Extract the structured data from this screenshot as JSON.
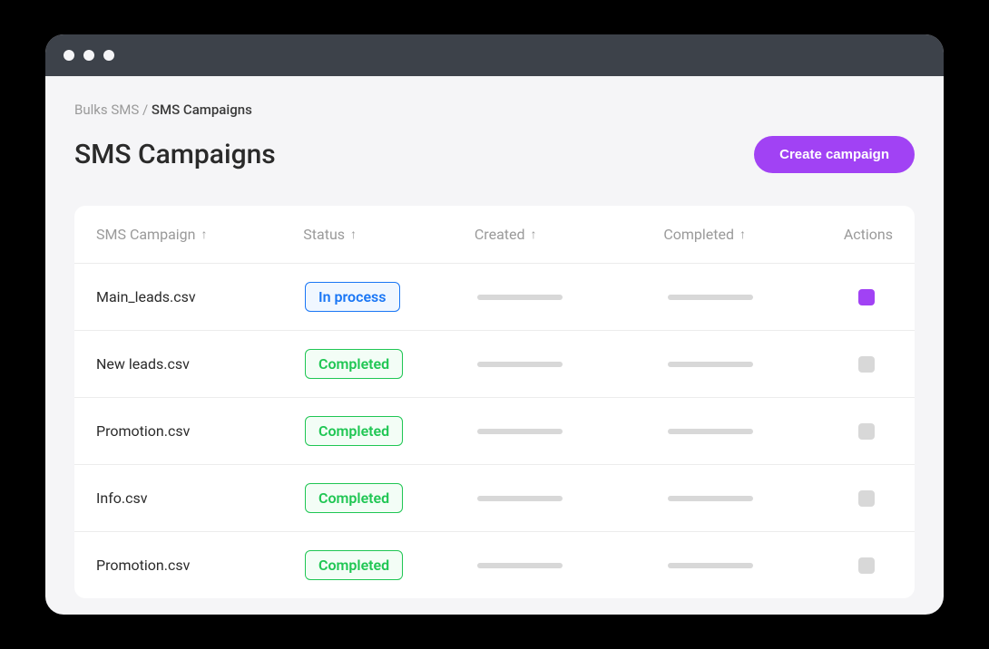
{
  "breadcrumb": {
    "parent": "Bulks SMS",
    "separator": "/",
    "current": "SMS Campaigns"
  },
  "page_title": "SMS Campaigns",
  "create_button_label": "Create campaign",
  "table": {
    "headers": {
      "name": "SMS Campaign",
      "status": "Status",
      "created": "Created",
      "completed": "Completed",
      "actions": "Actions"
    },
    "rows": [
      {
        "name": "Main_leads.csv",
        "status": "In process",
        "status_type": "in-process",
        "action_active": true
      },
      {
        "name": "New leads.csv",
        "status": "Completed",
        "status_type": "completed",
        "action_active": false
      },
      {
        "name": "Promotion.csv",
        "status": "Completed",
        "status_type": "completed",
        "action_active": false
      },
      {
        "name": "Info.csv",
        "status": "Completed",
        "status_type": "completed",
        "action_active": false
      },
      {
        "name": "Promotion.csv",
        "status": "Completed",
        "status_type": "completed",
        "action_active": false
      }
    ]
  },
  "colors": {
    "accent": "#a142f4",
    "status_in_process": "#1976f5",
    "status_completed": "#1fc653"
  }
}
